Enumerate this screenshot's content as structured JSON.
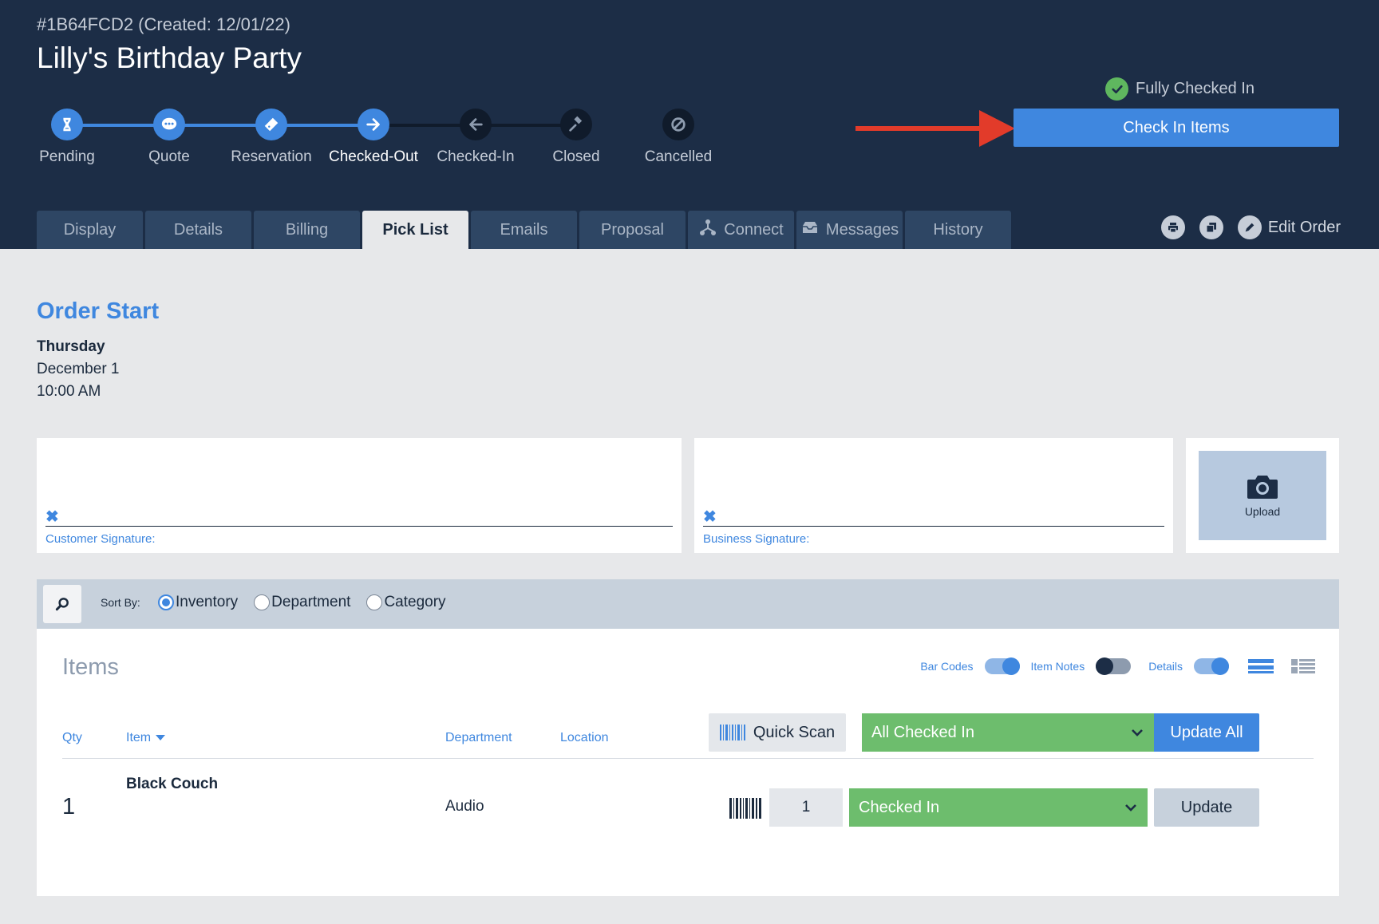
{
  "order": {
    "id_line": "#1B64FCD2 (Created: 12/01/22)",
    "title": "Lilly's Birthday Party"
  },
  "steps": [
    {
      "label": "Pending",
      "state": "done",
      "icon": "hourglass-icon"
    },
    {
      "label": "Quote",
      "state": "done",
      "icon": "chat-bubble-icon"
    },
    {
      "label": "Reservation",
      "state": "done",
      "icon": "ticket-icon"
    },
    {
      "label": "Checked-Out",
      "state": "current",
      "icon": "arrow-right-icon"
    },
    {
      "label": "Checked-In",
      "state": "todo",
      "icon": "arrow-left-icon"
    },
    {
      "label": "Closed",
      "state": "todo",
      "icon": "gavel-icon"
    },
    {
      "label": "Cancelled",
      "state": "todo",
      "icon": "ban-icon"
    }
  ],
  "status": {
    "text": "Fully Checked In",
    "icon": "check-circle-icon"
  },
  "check_in_button": "Check In Items",
  "tabs": [
    {
      "label": "Display",
      "active": false
    },
    {
      "label": "Details",
      "active": false
    },
    {
      "label": "Billing",
      "active": false
    },
    {
      "label": "Pick List",
      "active": true
    },
    {
      "label": "Emails",
      "active": false
    },
    {
      "label": "Proposal",
      "active": false
    },
    {
      "label": "Connect",
      "active": false,
      "icon": "network-icon"
    },
    {
      "label": "Messages",
      "active": false,
      "icon": "inbox-icon"
    },
    {
      "label": "History",
      "active": false
    }
  ],
  "header_actions": {
    "print_icon": "printer-icon",
    "duplicate_icon": "copy-icon",
    "edit_icon": "pencil-icon",
    "edit_label": "Edit Order"
  },
  "order_start": {
    "title": "Order Start",
    "day": "Thursday",
    "date": "December 1",
    "time": "10:00 AM"
  },
  "signatures": {
    "x_mark": "✖",
    "customer_label": "Customer Signature:",
    "business_label": "Business Signature:",
    "upload_label": "Upload",
    "upload_icon": "camera-icon"
  },
  "sort": {
    "label": "Sort By:",
    "options": [
      {
        "label": "Inventory",
        "selected": true
      },
      {
        "label": "Department",
        "selected": false
      },
      {
        "label": "Category",
        "selected": false
      }
    ]
  },
  "items_panel": {
    "title": "Items",
    "toggles": [
      {
        "label": "Bar Codes",
        "on": true
      },
      {
        "label": "Item Notes",
        "on": false
      },
      {
        "label": "Details",
        "on": true
      }
    ],
    "columns": {
      "qty": "Qty",
      "item": "Item",
      "department": "Department",
      "location": "Location"
    },
    "quick_scan": "Quick Scan",
    "bulk_status": "All Checked In",
    "update_all": "Update All",
    "rows": [
      {
        "qty": "1",
        "name": "Black Couch",
        "department": "Audio",
        "location": "",
        "scan_qty": "1",
        "status": "Checked In",
        "update": "Update"
      }
    ]
  },
  "colors": {
    "header_bg": "#1c2d46",
    "accent": "#3f87df",
    "success": "#6dbd6d",
    "arrow": "#e23b2a"
  }
}
